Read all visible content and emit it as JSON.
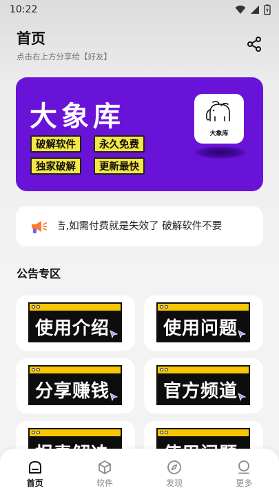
{
  "status_bar": {
    "time": "10:22"
  },
  "header": {
    "title": "首页",
    "subtitle": "点击右上方分享给【好友】"
  },
  "banner": {
    "title": "大象库",
    "tags": [
      "破解软件",
      "永久免费",
      "独家破解",
      "更新最快"
    ],
    "logo_text": "大象库",
    "background_color": "#6a13d8",
    "tag_color": "#f6e744"
  },
  "notice": {
    "text": "告,如需付费就是失效了  破解软件不要"
  },
  "section": {
    "title": "公告专区"
  },
  "cards": [
    {
      "label": "使用介绍"
    },
    {
      "label": "使用问题"
    },
    {
      "label": "分享赚钱"
    },
    {
      "label": "官方频道"
    },
    {
      "label": "报毒解决"
    },
    {
      "label": "使用问题"
    }
  ],
  "tabbar": {
    "items": [
      {
        "label": "首页",
        "icon": "home-icon",
        "active": true
      },
      {
        "label": "软件",
        "icon": "cube-icon",
        "active": false
      },
      {
        "label": "发现",
        "icon": "compass-icon",
        "active": false
      },
      {
        "label": "更多",
        "icon": "user-icon",
        "active": false
      }
    ]
  }
}
